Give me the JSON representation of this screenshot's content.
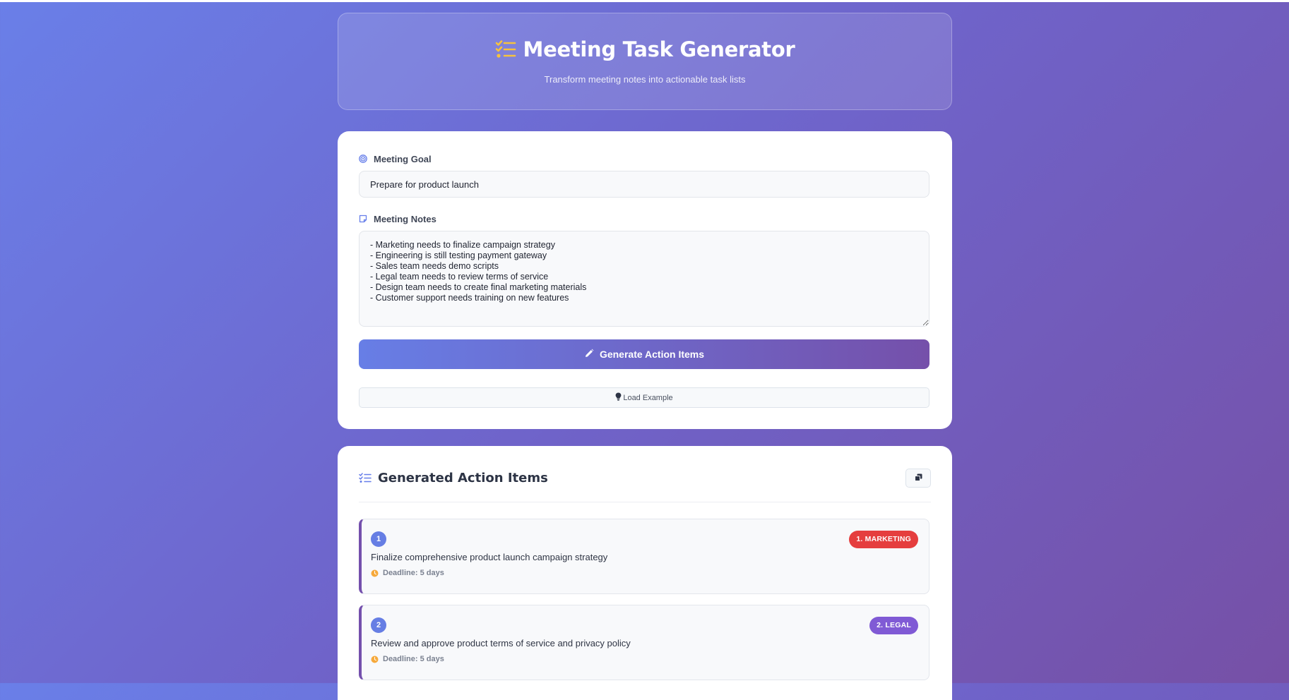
{
  "header": {
    "title": "Meeting Task Generator",
    "subtitle": "Transform meeting notes into actionable task lists"
  },
  "form": {
    "goal_label": "Meeting Goal",
    "goal_value": "Prepare for product launch",
    "notes_label": "Meeting Notes",
    "notes_value": "- Marketing needs to finalize campaign strategy\n- Engineering is still testing payment gateway\n- Sales team needs demo scripts\n- Legal team needs to review terms of service\n- Design team needs to create final marketing materials\n- Customer support needs training on new features",
    "generate_label": "Generate Action Items",
    "load_example_label": "Load Example"
  },
  "results": {
    "title": "Generated Action Items",
    "tasks": [
      {
        "number": "1",
        "badge": "1. MARKETING",
        "badge_color": "#e53e3e",
        "text": "Finalize comprehensive product launch campaign strategy",
        "deadline": "Deadline: 5 days"
      },
      {
        "number": "2",
        "badge": "2. LEGAL",
        "badge_color": "#805ad5",
        "text": "Review and approve product terms of service and privacy policy",
        "deadline": "Deadline: 5 days"
      }
    ]
  },
  "colors": {
    "accent": "#667eea",
    "accent_end": "#764ba2",
    "header_icon": "#f6c23e",
    "deadline_icon": "#f6a93b"
  },
  "icons": {
    "header": "tasks-icon",
    "goal": "target-icon",
    "notes": "sticky-note-icon",
    "generate": "pencil-icon",
    "load_example": "lightbulb-icon",
    "results": "tasks-icon",
    "copy": "copy-icon",
    "deadline": "clock-icon"
  }
}
